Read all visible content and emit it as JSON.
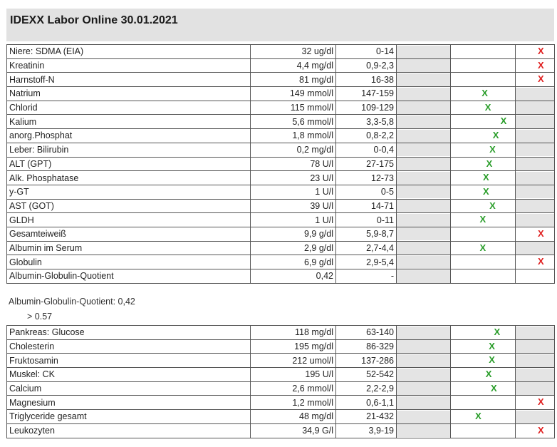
{
  "title": "IDEXX Labor Online 30.01.2021",
  "colors": {
    "ok": "#2a9d2a",
    "high": "#e02020",
    "header_bg": "#e2e2e2"
  },
  "table1": [
    {
      "name": "Niere: SDMA (EIA)",
      "value": "32 ug/dl",
      "ref": "0-14",
      "mark": "X",
      "status": "high",
      "pos": 0.0
    },
    {
      "name": "Kreatinin",
      "value": "4,4 mg/dl",
      "ref": "0,9-2,3",
      "mark": "X",
      "status": "high",
      "pos": 0.0
    },
    {
      "name": "Harnstoff-N",
      "value": "81 mg/dl",
      "ref": "16-38",
      "mark": "X",
      "status": "high",
      "pos": 0.0
    },
    {
      "name": "Natrium",
      "value": "149 mmol/l",
      "ref": "147-159",
      "mark": "X",
      "status": "ok",
      "pos": 0.53
    },
    {
      "name": "Chlorid",
      "value": "115 mmol/l",
      "ref": "109-129",
      "mark": "X",
      "status": "ok",
      "pos": 0.58
    },
    {
      "name": "Kalium",
      "value": "5,6 mmol/l",
      "ref": "3,3-5,8",
      "mark": "X",
      "status": "ok",
      "pos": 0.82
    },
    {
      "name": "anorg.Phosphat",
      "value": "1,8 mmol/l",
      "ref": "0,8-2,2",
      "mark": "X",
      "status": "ok",
      "pos": 0.7
    },
    {
      "name": "Leber: Bilirubin",
      "value": "0,2 mg/dl",
      "ref": "0-0,4",
      "mark": "X",
      "status": "ok",
      "pos": 0.65
    },
    {
      "name": "ALT (GPT)",
      "value": "78 U/l",
      "ref": "27-175",
      "mark": "X",
      "status": "ok",
      "pos": 0.6
    },
    {
      "name": "Alk. Phosphatase",
      "value": "23 U/l",
      "ref": "12-73",
      "mark": "X",
      "status": "ok",
      "pos": 0.55
    },
    {
      "name": "y-GT",
      "value": "1 U/l",
      "ref": "0-5",
      "mark": "X",
      "status": "ok",
      "pos": 0.55
    },
    {
      "name": "AST (GOT)",
      "value": "39 U/l",
      "ref": "14-71",
      "mark": "X",
      "status": "ok",
      "pos": 0.65
    },
    {
      "name": "GLDH",
      "value": "1 U/l",
      "ref": "0-11",
      "mark": "X",
      "status": "ok",
      "pos": 0.5
    },
    {
      "name": "Gesamteiweiß",
      "value": "9,9 g/dl",
      "ref": "5,9-8,7",
      "mark": "X",
      "status": "high",
      "pos": 0.0
    },
    {
      "name": "Albumin im Serum",
      "value": "2,9 g/dl",
      "ref": "2,7-4,4",
      "mark": "X",
      "status": "ok",
      "pos": 0.5
    },
    {
      "name": "Globulin",
      "value": "6,9 g/dl",
      "ref": "2,9-5,4",
      "mark": "X",
      "status": "high",
      "pos": 0.0
    },
    {
      "name": "Albumin-Globulin-Quotient",
      "value": "0,42",
      "ref": "-",
      "mark": "",
      "status": "none",
      "pos": 0.0
    }
  ],
  "note_line1": "Albumin-Globulin-Quotient: 0,42",
  "note_line2": "> 0.57",
  "table2": [
    {
      "name": "Pankreas: Glucose",
      "value": "118 mg/dl",
      "ref": "63-140",
      "mark": "X",
      "status": "ok",
      "pos": 0.72
    },
    {
      "name": "Cholesterin",
      "value": "195 mg/dl",
      "ref": "86-329",
      "mark": "X",
      "status": "ok",
      "pos": 0.64
    },
    {
      "name": "Fruktosamin",
      "value": "212 umol/l",
      "ref": "137-286",
      "mark": "X",
      "status": "ok",
      "pos": 0.64
    },
    {
      "name": "Muskel: CK",
      "value": "195 U/l",
      "ref": "52-542",
      "mark": "X",
      "status": "ok",
      "pos": 0.59
    },
    {
      "name": "Calcium",
      "value": "2,6 mmol/l",
      "ref": "2,2-2,9",
      "mark": "X",
      "status": "ok",
      "pos": 0.67
    },
    {
      "name": "Magnesium",
      "value": "1,2 mmol/l",
      "ref": "0,6-1,1",
      "mark": "X",
      "status": "high",
      "pos": 0.0
    },
    {
      "name": "Triglyceride gesamt",
      "value": "48 mg/dl",
      "ref": "21-432",
      "mark": "X",
      "status": "ok",
      "pos": 0.43
    },
    {
      "name": "Leukozyten",
      "value": "34,9 G/l",
      "ref": "3,9-19",
      "mark": "X",
      "status": "high",
      "pos": 0.0
    }
  ]
}
